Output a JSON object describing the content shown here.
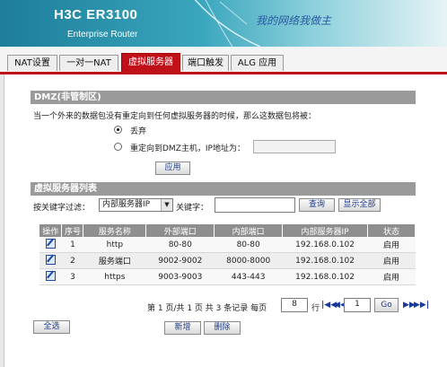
{
  "banner": {
    "brand": "H3C ER3100",
    "subtitle": "Enterprise Router",
    "slogan": "我的网络我做主"
  },
  "tabs": [
    {
      "label": "NAT设置",
      "active": false
    },
    {
      "label": "一对一NAT",
      "active": false
    },
    {
      "label": "虚拟服务器",
      "active": true
    },
    {
      "label": "端口触发",
      "active": false
    },
    {
      "label": "ALG 应用",
      "active": false
    }
  ],
  "dmz": {
    "title": "DMZ(非管制区)",
    "description": "当一个外来的数据包没有重定向到任何虚拟服务器的时候，那么这数据包将被：",
    "option_drop": "丢弃",
    "option_redirect": "重定向到DMZ主机，IP地址为：",
    "ip_value": "",
    "apply_label": "应用"
  },
  "server_list": {
    "title": "虚拟服务器列表",
    "filter_label": "按关键字过滤：",
    "filter_select": "内部服务器IP",
    "keyword_label": "关键字：",
    "keyword_value": "",
    "query_label": "查询",
    "show_all_label": "显示全部",
    "columns": [
      "操作",
      "序号",
      "服务名称",
      "外部端口",
      "内部端口",
      "内部服务器IP",
      "状态"
    ],
    "rows": [
      {
        "index": "1",
        "name": "http",
        "ext_port": "80-80",
        "int_port": "80-80",
        "ip": "192.168.0.102",
        "status": "启用"
      },
      {
        "index": "2",
        "name": "服务端口",
        "ext_port": "9002-9002",
        "int_port": "8000-8000",
        "ip": "192.168.0.102",
        "status": "启用"
      },
      {
        "index": "3",
        "name": "https",
        "ext_port": "9003-9003",
        "int_port": "443-443",
        "ip": "192.168.0.102",
        "status": "启用"
      }
    ]
  },
  "pagination": {
    "summary": "第 1 页/共 1 页 共 3 条记录 每页",
    "per_page": "8",
    "rows_label": "行",
    "page_value": "1",
    "go_label": "Go"
  },
  "actions": {
    "select_all": "全选",
    "add": "新增",
    "delete": "删除"
  },
  "colors": {
    "accent": "#c0101a",
    "section": "#9a9a9a",
    "link": "#1c3a8a"
  }
}
